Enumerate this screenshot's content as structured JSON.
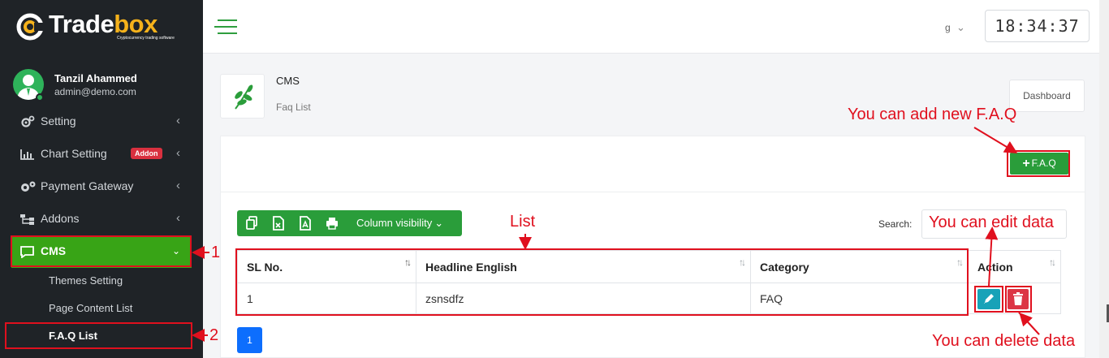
{
  "brand": {
    "logo_text_main": "Trade",
    "logo_text_accent": "box",
    "tagline": "Cryptocurrency trading software",
    "accent_color": "#38a416",
    "logo_accent_color": "#f5b21b"
  },
  "user": {
    "name": "Tanzil Ahammed",
    "email": "admin@demo.com"
  },
  "sidebar": {
    "items": [
      {
        "label": "Setting",
        "icon": "gears-icon"
      },
      {
        "label": "Chart Setting",
        "icon": "bar-chart-icon",
        "badge": "Addon"
      },
      {
        "label": "Payment Gateway",
        "icon": "cogs-icon"
      },
      {
        "label": "Addons",
        "icon": "sitemap-icon"
      },
      {
        "label": "CMS",
        "icon": "comment-icon",
        "active": true
      }
    ],
    "sub_items": [
      {
        "label": "Themes Setting"
      },
      {
        "label": "Page Content List"
      },
      {
        "label": "F.A.Q List",
        "active": true
      }
    ]
  },
  "topbar": {
    "language": "g",
    "clock": "18:34:37"
  },
  "page_header": {
    "title": "CMS",
    "subtitle": "Faq List",
    "dashboard_button": "Dashboard",
    "icon": "leaf-icon"
  },
  "toolbar": {
    "add_button": "F.A.Q",
    "column_visibility": "Column visibility",
    "export_icons": [
      "copy-icon",
      "csv-icon",
      "pdf-icon",
      "print-icon"
    ],
    "search_label": "Search:",
    "search_value": ""
  },
  "table": {
    "columns": [
      "SL No.",
      "Headline English",
      "Category",
      "Action"
    ],
    "rows": [
      {
        "sl": "1",
        "headline": "zsnsdfz",
        "category": "FAQ"
      }
    ]
  },
  "pagination": {
    "current_page": "1"
  },
  "annotations": {
    "callout_add": "You can add new F.A.Q",
    "callout_list": "List",
    "callout_edit": "You can edit data",
    "callout_delete": "You can delete data",
    "step_1": "1",
    "step_2": "2",
    "highlight_color": "#e0101e"
  }
}
